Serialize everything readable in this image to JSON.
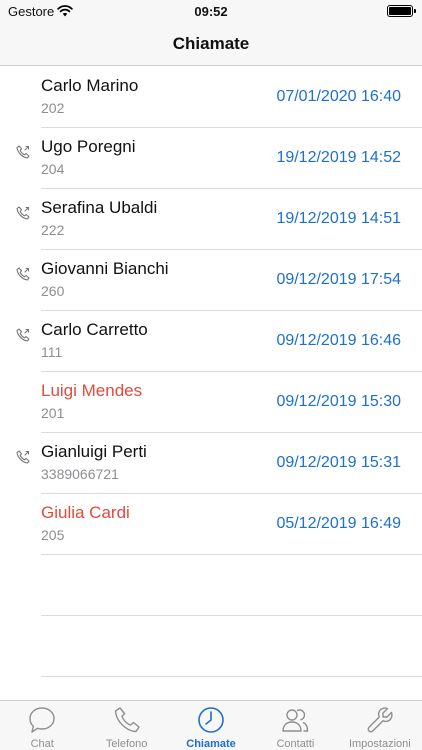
{
  "status_bar": {
    "carrier": "Gestore",
    "time": "09:52"
  },
  "nav": {
    "title": "Chiamate"
  },
  "calls": [
    {
      "name": "Carlo Marino",
      "number": "202",
      "datetime": "07/01/2020 16:40",
      "missed": false,
      "icon": ""
    },
    {
      "name": "Ugo Poregni",
      "number": "204",
      "datetime": "19/12/2019 14:52",
      "missed": false,
      "icon": "outgoing-call-icon"
    },
    {
      "name": "Serafina Ubaldi",
      "number": "222",
      "datetime": "19/12/2019 14:51",
      "missed": false,
      "icon": "outgoing-call-icon"
    },
    {
      "name": "Giovanni Bianchi",
      "number": "260",
      "datetime": "09/12/2019 17:54",
      "missed": false,
      "icon": "outgoing-call-icon"
    },
    {
      "name": "Carlo Carretto",
      "number": "111",
      "datetime": "09/12/2019 16:46",
      "missed": false,
      "icon": "outgoing-call-icon"
    },
    {
      "name": "Luigi Mendes",
      "number": "201",
      "datetime": "09/12/2019 15:30",
      "missed": true,
      "icon": ""
    },
    {
      "name": "Gianluigi Perti",
      "number": "3389066721",
      "datetime": "09/12/2019 15:31",
      "missed": false,
      "icon": "outgoing-call-icon"
    },
    {
      "name": "Giulia Cardi",
      "number": "205",
      "datetime": "05/12/2019 16:49",
      "missed": true,
      "icon": ""
    }
  ],
  "tabs": [
    {
      "label": "Chat",
      "icon": "chat-bubble-icon",
      "active": false
    },
    {
      "label": "Telefono",
      "icon": "phone-handset-icon",
      "active": false
    },
    {
      "label": "Chiamate",
      "icon": "clock-icon",
      "active": true
    },
    {
      "label": "Contatti",
      "icon": "contacts-icon",
      "active": false
    },
    {
      "label": "Impostazioni",
      "icon": "wrench-icon",
      "active": false
    }
  ],
  "colors": {
    "accent": "#1d6fd0",
    "missed": "#e34a3b",
    "secondary_text": "#8e8e93"
  }
}
